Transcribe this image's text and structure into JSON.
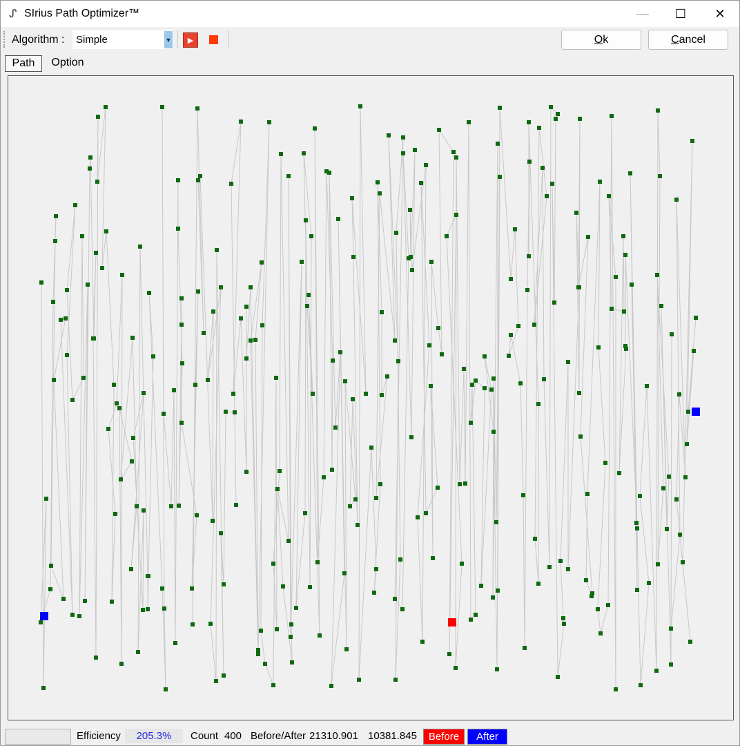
{
  "window": {
    "title": "SIrius Path Optimizer™",
    "icon": "path-glyph-icon",
    "minimize": "—",
    "maximize": "☐",
    "close": "✕"
  },
  "toolbar": {
    "algorithm_label": "Algorithm :",
    "algorithm_value": "Simple",
    "run_icon": "play-icon",
    "stop_icon": "stop-icon",
    "ok_label": "Ok",
    "ok_mnemonic": "O",
    "ok_rest": "k",
    "cancel_label": "Cancel",
    "cancel_mnemonic": "C",
    "cancel_rest": "ancel"
  },
  "tabs": [
    {
      "label": "Path",
      "active": true
    },
    {
      "label": "Option",
      "active": false
    }
  ],
  "path_view": {
    "point_color": "#0f6a0f",
    "line_color": "#c8c8c8",
    "start_marker_color": "#0000ff",
    "end_marker_color": "#ff0000"
  },
  "status": {
    "efficiency_label": "Efficiency",
    "efficiency_value": "205.3%",
    "count_label": "Count",
    "count_value": "400",
    "before_after_label": "Before/After",
    "before_value": "21310.901",
    "after_value": "10381.845",
    "legend_before": "Before",
    "legend_after": "After",
    "legend_before_color": "#ff0000",
    "legend_after_color": "#0000ff"
  }
}
